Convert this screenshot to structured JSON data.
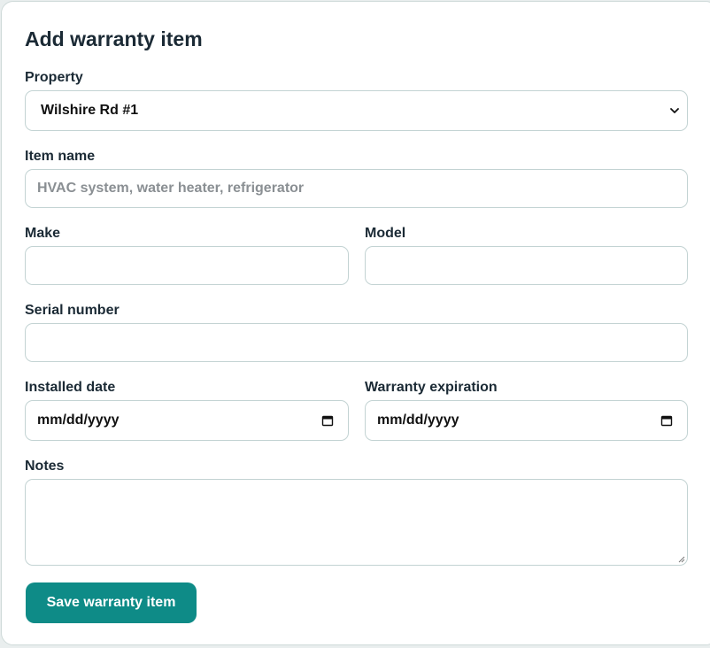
{
  "form": {
    "title": "Add warranty item",
    "property": {
      "label": "Property",
      "selected": "Wilshire Rd #1"
    },
    "item_name": {
      "label": "Item name",
      "placeholder": "HVAC system, water heater, refrigerator",
      "value": ""
    },
    "make": {
      "label": "Make",
      "value": ""
    },
    "model": {
      "label": "Model",
      "value": ""
    },
    "serial_number": {
      "label": "Serial number",
      "value": ""
    },
    "installed_date": {
      "label": "Installed date",
      "display": "mm/dd/yyyy"
    },
    "warranty_expiration": {
      "label": "Warranty expiration",
      "display": "mm/dd/yyyy"
    },
    "notes": {
      "label": "Notes",
      "value": ""
    },
    "save_label": "Save warranty item"
  },
  "colors": {
    "accent": "#0e8b87",
    "border": "#c3d3d3",
    "text": "#1b2a35",
    "placeholder": "#8a8f93"
  },
  "icons": {
    "select": "chevron-down-icon",
    "date": "calendar-icon",
    "resize": "resize-grip-icon"
  }
}
